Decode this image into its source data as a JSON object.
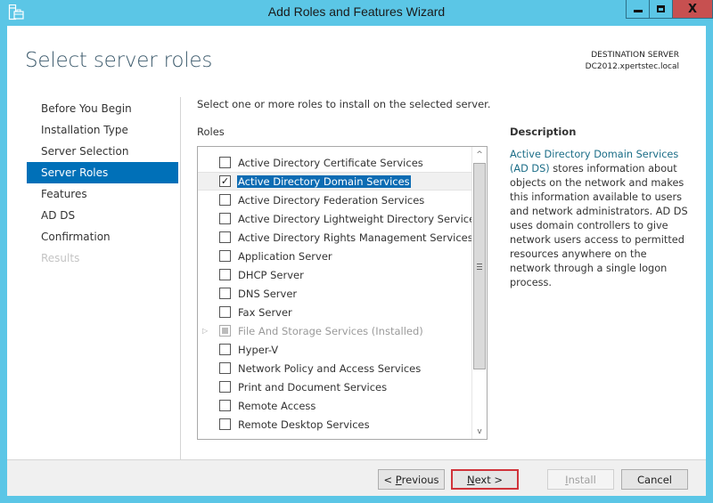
{
  "window": {
    "title": "Add Roles and Features Wizard",
    "controls": [
      "minimize",
      "maximize",
      "close"
    ],
    "close_glyph": "X"
  },
  "header": {
    "page_title": "Select server roles",
    "destination_label": "DESTINATION SERVER",
    "destination_server": "DC2012.xpertstec.local"
  },
  "nav": {
    "items": [
      {
        "label": "Before You Begin",
        "state": "normal"
      },
      {
        "label": "Installation Type",
        "state": "normal"
      },
      {
        "label": "Server Selection",
        "state": "normal"
      },
      {
        "label": "Server Roles",
        "state": "active"
      },
      {
        "label": "Features",
        "state": "normal"
      },
      {
        "label": "AD DS",
        "state": "normal"
      },
      {
        "label": "Confirmation",
        "state": "normal"
      },
      {
        "label": "Results",
        "state": "disabled"
      }
    ]
  },
  "main": {
    "instruction": "Select one or more roles to install on the selected server.",
    "roles_label": "Roles",
    "roles": [
      {
        "label": "Active Directory Certificate Services",
        "checked": false
      },
      {
        "label": "Active Directory Domain Services",
        "checked": true,
        "selected": true
      },
      {
        "label": "Active Directory Federation Services",
        "checked": false
      },
      {
        "label": "Active Directory Lightweight Directory Services",
        "checked": false
      },
      {
        "label": "Active Directory Rights Management Services",
        "checked": false
      },
      {
        "label": "Application Server",
        "checked": false
      },
      {
        "label": "DHCP Server",
        "checked": false
      },
      {
        "label": "DNS Server",
        "checked": false
      },
      {
        "label": "Fax Server",
        "checked": false
      },
      {
        "label": "File And Storage Services (Installed)",
        "checked": "partial",
        "expandable": true,
        "disabled": true
      },
      {
        "label": "Hyper-V",
        "checked": false
      },
      {
        "label": "Network Policy and Access Services",
        "checked": false
      },
      {
        "label": "Print and Document Services",
        "checked": false
      },
      {
        "label": "Remote Access",
        "checked": false
      },
      {
        "label": "Remote Desktop Services",
        "checked": false
      }
    ],
    "check_glyph": "✓",
    "expander_glyph": "▷",
    "scroll_up_glyph": "^",
    "scroll_down_glyph": "v"
  },
  "description": {
    "title": "Description",
    "link_text": "Active Directory Domain Services (AD DS)",
    "body": " stores information about objects on the network and makes this information available to users and network administrators. AD DS uses domain controllers to give network users access to permitted resources anywhere on the network through a single logon process."
  },
  "footer": {
    "previous": {
      "prefix": "< ",
      "mnemonic": "P",
      "rest": "revious",
      "enabled": true
    },
    "next": {
      "mnemonic": "N",
      "rest": "ext >",
      "enabled": true,
      "highlighted": true
    },
    "install": {
      "mnemonic": "I",
      "rest": "nstall",
      "enabled": false
    },
    "cancel": {
      "label": "Cancel",
      "enabled": true
    }
  },
  "colors": {
    "titlebar": "#5bc6e6",
    "accent": "#0070b8",
    "link": "#1b6d87",
    "close_button": "#c75050",
    "next_highlight": "#d0333a"
  }
}
